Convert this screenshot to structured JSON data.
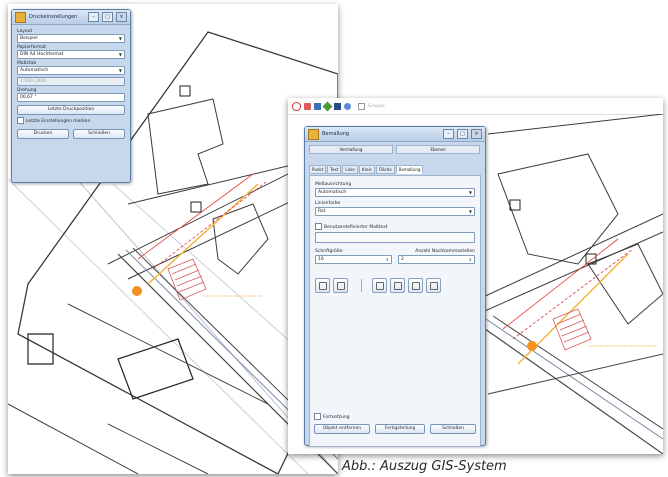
{
  "caption": "Abb.: Auszug GIS-System",
  "left_dialog": {
    "title": "Druckeinstellungen",
    "layout_label": "Layout",
    "layout_value": "Beispiel",
    "paper_label": "Papierformat",
    "paper_value": "DIN A4 Hochformat",
    "scale_label": "Maßstab",
    "scale_value": "Automatisch",
    "dpi_value": "1:100 (300)",
    "rotation_label": "Drehung",
    "rotation_value": "00,67 °",
    "save_position_label": "Letzte Druckposition",
    "checkbox_label": "Letzte Einstellungen merken",
    "print_button": "Drucken",
    "cancel_button": "Schließen"
  },
  "right_dialog": {
    "toolbar_text": "Gruppe",
    "title": "Bemaßung",
    "top_tabs": [
      "Vermaßung",
      "Ebenen"
    ],
    "tabs": [
      "Punkt",
      "Text",
      "Linie",
      "Kreis",
      "Fläche",
      "Bemaßung"
    ],
    "measure_label": "Meßausrichtung",
    "measure_value": "Automatisch",
    "unit_label": "Linienfarbe",
    "unit_value": "Rot",
    "custom_label": "Benutzerdefinierter Maßtext",
    "font_label": "Schriftgröße",
    "decimals_label": "Anzahl Nachkommastellen",
    "font_value": "16",
    "decimals_value": "2",
    "snap_label": "Fortsetzung",
    "delete_button": "Objekt entfernen",
    "confirm_button": "Fertigstellung",
    "close_button": "Schließen"
  },
  "colors": {
    "parcel_lines": "#3a3a3a",
    "road_lines": "#b8c4d8",
    "dimension": "#e0403a",
    "building_hatch": "#d85a5a",
    "pipeline": "#f2b640",
    "marker": "#f39020"
  }
}
